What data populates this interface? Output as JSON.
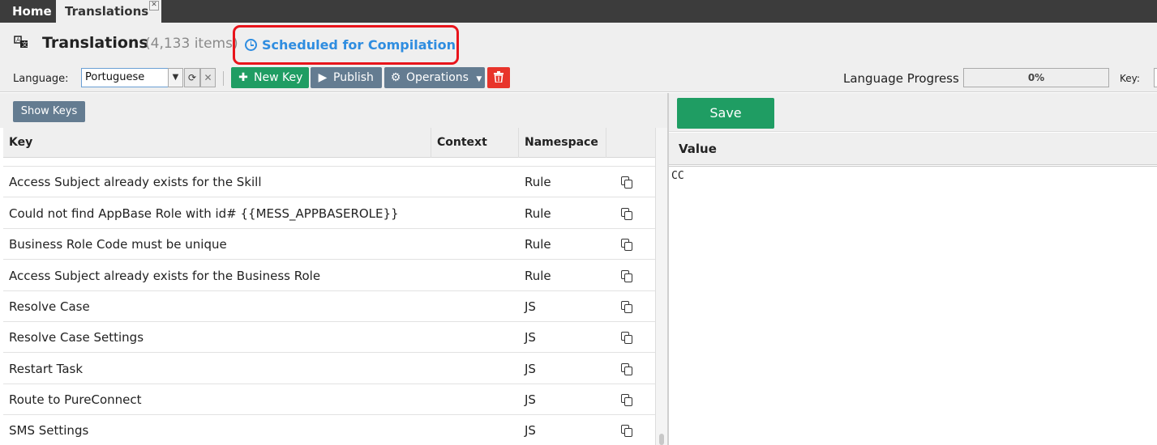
{
  "tabs": [
    {
      "label": "Home"
    },
    {
      "label": "Translations"
    }
  ],
  "header": {
    "title": "Translations",
    "count": "(4,133 items)",
    "status": "Scheduled for Compilation",
    "highlight_color": "#e8141b",
    "status_color": "#2f8de0"
  },
  "toolbar": {
    "language_label": "Language:",
    "language_value": "Portuguese",
    "new_key": "New Key",
    "publish": "Publish",
    "operations": "Operations",
    "progress_label": "Language Progress",
    "progress_text": "0%",
    "progress_value": 0,
    "key_label": "Key:"
  },
  "left": {
    "show_keys": "Show Keys",
    "columns": [
      "Key",
      "Context",
      "Namespace",
      ""
    ],
    "rows": [
      {
        "key": "Access Subject already exists for the Skill",
        "context": "",
        "namespace": "Rule"
      },
      {
        "key": "Could not find AppBase Role with id# {{MESS_APPBASEROLE}}",
        "context": "",
        "namespace": "Rule"
      },
      {
        "key": "Business Role Code must be unique",
        "context": "",
        "namespace": "Rule"
      },
      {
        "key": "Access Subject already exists for the Business Role",
        "context": "",
        "namespace": "Rule"
      },
      {
        "key": "Resolve Case",
        "context": "",
        "namespace": "JS"
      },
      {
        "key": "Resolve Case Settings",
        "context": "",
        "namespace": "JS"
      },
      {
        "key": "Restart Task",
        "context": "",
        "namespace": "JS"
      },
      {
        "key": "Route to PureConnect",
        "context": "",
        "namespace": "JS"
      },
      {
        "key": "SMS Settings",
        "context": "",
        "namespace": "JS"
      }
    ]
  },
  "right": {
    "save": "Save",
    "value_title": "Value",
    "value": "CC"
  },
  "colors": {
    "green": "#1f9d63",
    "slate": "#647c91",
    "red": "#e8342b"
  }
}
